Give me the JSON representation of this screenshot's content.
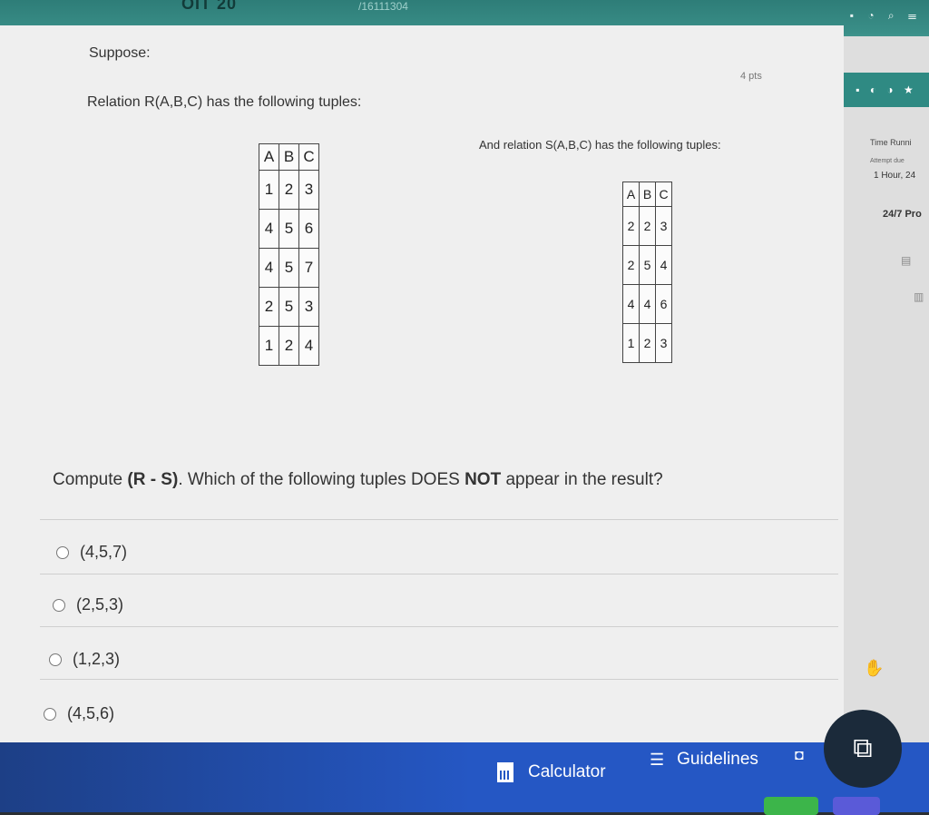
{
  "header": {
    "course_code": "OIT 20",
    "url_fragment": "/16111304"
  },
  "sidebar": {
    "timer_title": "Time Runni",
    "attempt_due": "Attempt due",
    "hours": "1 Hour, 24",
    "support": "24/7 Pro"
  },
  "question": {
    "points": "4 pts",
    "intro": "Suppose:",
    "relation_r_text": "Relation R(A,B,C) has the following tuples:",
    "relation_s_text": "And relation S(A,B,C) has the following tuples:",
    "table_r": {
      "headers": [
        "A",
        "B",
        "C"
      ],
      "rows": [
        [
          "1",
          "2",
          "3"
        ],
        [
          "4",
          "5",
          "6"
        ],
        [
          "4",
          "5",
          "7"
        ],
        [
          "2",
          "5",
          "3"
        ],
        [
          "1",
          "2",
          "4"
        ]
      ]
    },
    "table_s": {
      "headers": [
        "A",
        "B",
        "C"
      ],
      "rows": [
        [
          "2",
          "2",
          "3"
        ],
        [
          "2",
          "5",
          "4"
        ],
        [
          "4",
          "4",
          "6"
        ],
        [
          "1",
          "2",
          "3"
        ]
      ]
    },
    "prompt_prefix": "Compute ",
    "prompt_bold": "(R - S)",
    "prompt_middle": ". Which of the following tuples DOES ",
    "prompt_not": "NOT",
    "prompt_suffix": " appear in the result?",
    "options": [
      "(4,5,7)",
      "(2,5,3)",
      "(1,2,3)",
      "(4,5,6)"
    ]
  },
  "footer": {
    "calculator_label": "Calculator",
    "guidelines_label": "Guidelines"
  },
  "colors": {
    "accent": "#2e7d78",
    "footer": "#2557c4"
  },
  "icons": [
    "calculator-icon",
    "list-icon",
    "camera-icon",
    "text-scan-icon",
    "radio-icon",
    "hand-icon"
  ]
}
